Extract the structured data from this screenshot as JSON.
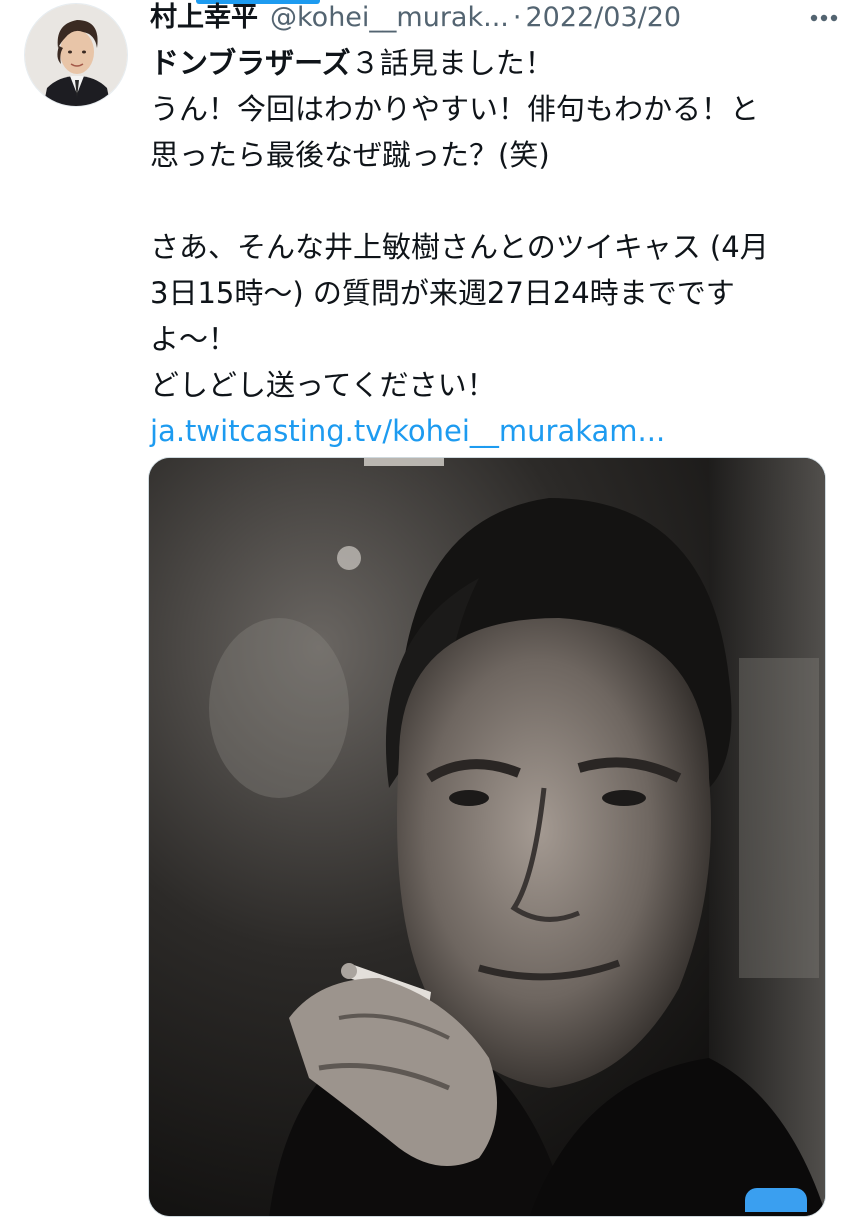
{
  "colors": {
    "accent": "#1d9bf0",
    "text_primary": "#0f1419",
    "text_secondary": "#536471"
  },
  "tweet": {
    "author_name": "村上幸平",
    "handle": "@kohei__murak...",
    "separator": "·",
    "date": "2022/03/20",
    "more_icon": "more-horizontal-icon",
    "lines": {
      "l1_bold": "ドンブラザーズ",
      "l1_rest": "３話見ました！",
      "l2": "うん！今回はわかりやすい！俳句もわかる！と",
      "l3": "思ったら最後なぜ蹴った？(笑)",
      "l5": "さあ、そんな井上敏樹さんとのツイキャス (4月",
      "l6": "3日15時〜) の質問が来週27日24時までです",
      "l7": "よ〜！",
      "l8": "どしどし送ってください！"
    },
    "link_text": "ja.twitcasting.tv/kohei__murakam...",
    "media_alt_icon": "photo-icon"
  }
}
